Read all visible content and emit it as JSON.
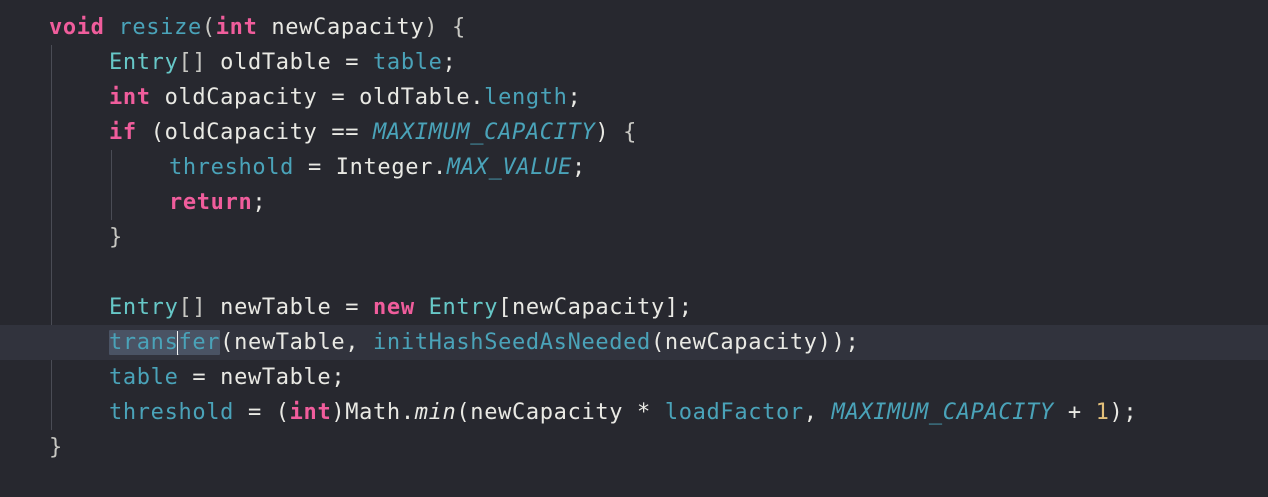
{
  "editor": {
    "language": "java",
    "theme_colors": {
      "background": "#27282f",
      "current_line": "#31333d",
      "keyword": "#f05d9c",
      "type": "#67c8c8",
      "field": "#4aa3b9",
      "text": "#e9e9e4",
      "number": "#e3c07a",
      "selection": "#4a5364"
    },
    "lines": [
      {
        "indent": 0,
        "tokens": [
          {
            "t": "void",
            "c": "kw"
          },
          {
            "t": " ",
            "c": ""
          },
          {
            "t": "resize",
            "c": "method"
          },
          {
            "t": "(",
            "c": "punct"
          },
          {
            "t": "int",
            "c": "kw"
          },
          {
            "t": " newCapacity",
            "c": ""
          },
          {
            "t": ")",
            "c": "punct"
          },
          {
            "t": " {",
            "c": "punct"
          }
        ]
      },
      {
        "indent": 1,
        "tokens": [
          {
            "t": "Entry",
            "c": "type"
          },
          {
            "t": "[]",
            "c": "punct"
          },
          {
            "t": " oldTable = ",
            "c": ""
          },
          {
            "t": "table",
            "c": "field"
          },
          {
            "t": ";",
            "c": ""
          }
        ]
      },
      {
        "indent": 1,
        "tokens": [
          {
            "t": "int",
            "c": "kw"
          },
          {
            "t": " oldCapacity = oldTable.",
            "c": ""
          },
          {
            "t": "length",
            "c": "field"
          },
          {
            "t": ";",
            "c": ""
          }
        ]
      },
      {
        "indent": 1,
        "tokens": [
          {
            "t": "if",
            "c": "kw"
          },
          {
            "t": " (oldCapacity == ",
            "c": ""
          },
          {
            "t": "MAXIMUM_CAPACITY",
            "c": "const"
          },
          {
            "t": ")",
            "c": ""
          },
          {
            "t": " {",
            "c": "punct"
          }
        ]
      },
      {
        "indent": 2,
        "tokens": [
          {
            "t": "threshold",
            "c": "field"
          },
          {
            "t": " = Integer.",
            "c": ""
          },
          {
            "t": "MAX_VALUE",
            "c": "const"
          },
          {
            "t": ";",
            "c": ""
          }
        ]
      },
      {
        "indent": 2,
        "tokens": [
          {
            "t": "return",
            "c": "kw"
          },
          {
            "t": ";",
            "c": ""
          }
        ]
      },
      {
        "indent": 1,
        "tokens": [
          {
            "t": "}",
            "c": "punct"
          }
        ]
      },
      {
        "indent": 0,
        "tokens": []
      },
      {
        "indent": 1,
        "tokens": [
          {
            "t": "Entry",
            "c": "type"
          },
          {
            "t": "[]",
            "c": "punct"
          },
          {
            "t": " newTable = ",
            "c": ""
          },
          {
            "t": "new",
            "c": "kw"
          },
          {
            "t": " ",
            "c": ""
          },
          {
            "t": "Entry",
            "c": "type"
          },
          {
            "t": "[newCapacity];",
            "c": ""
          }
        ]
      },
      {
        "indent": 1,
        "current": true,
        "tokens": [
          {
            "t": "trans",
            "c": "method sel"
          },
          {
            "t": "",
            "c": "caret"
          },
          {
            "t": "fer",
            "c": "method sel"
          },
          {
            "t": "(newTable, ",
            "c": ""
          },
          {
            "t": "initHashSeedAsNeeded",
            "c": "method"
          },
          {
            "t": "(newCapacity));",
            "c": ""
          }
        ]
      },
      {
        "indent": 1,
        "tokens": [
          {
            "t": "table",
            "c": "field"
          },
          {
            "t": " = newTable;",
            "c": ""
          }
        ]
      },
      {
        "indent": 1,
        "tokens": [
          {
            "t": "threshold",
            "c": "field"
          },
          {
            "t": " = (",
            "c": ""
          },
          {
            "t": "int",
            "c": "kw"
          },
          {
            "t": ")Math.",
            "c": ""
          },
          {
            "t": "min",
            "c": "static-call"
          },
          {
            "t": "(newCapacity * ",
            "c": ""
          },
          {
            "t": "loadFactor",
            "c": "field"
          },
          {
            "t": ", ",
            "c": ""
          },
          {
            "t": "MAXIMUM_CAPACITY",
            "c": "const"
          },
          {
            "t": " + ",
            "c": ""
          },
          {
            "t": "1",
            "c": "num"
          },
          {
            "t": ");",
            "c": ""
          }
        ]
      },
      {
        "indent": 0,
        "tokens": [
          {
            "t": "}",
            "c": "punct"
          }
        ]
      }
    ]
  }
}
